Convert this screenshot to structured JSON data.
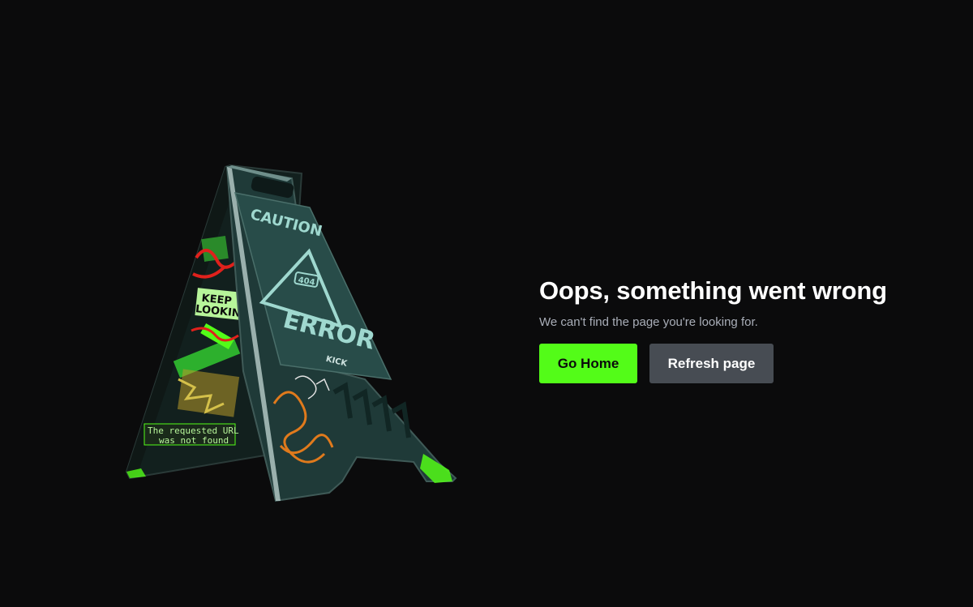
{
  "illustration": {
    "alt": "404 caution sign",
    "sign_caution": "CAUTION",
    "sign_code": "404",
    "sign_error": "ERROR",
    "sign_brand": "KICK",
    "sticker_keep": "KEEP",
    "sticker_looking": "LOOKIN",
    "sticker_line1": "The requested URL",
    "sticker_line2": "was not found",
    "colors": {
      "accent": "#53fc18",
      "sign_teal": "#1f3a38",
      "sign_text": "#9fd8cf",
      "graffiti_orange": "#e07a1c"
    }
  },
  "error": {
    "title": "Oops, something went wrong",
    "message": "We can't find the page you're looking for."
  },
  "actions": {
    "home_label": "Go Home",
    "refresh_label": "Refresh page"
  },
  "colors": {
    "background": "#0b0b0c",
    "primary": "#53fc18",
    "secondary": "#474c53",
    "title": "#ffffff",
    "subtitle": "#a9aeb8"
  }
}
